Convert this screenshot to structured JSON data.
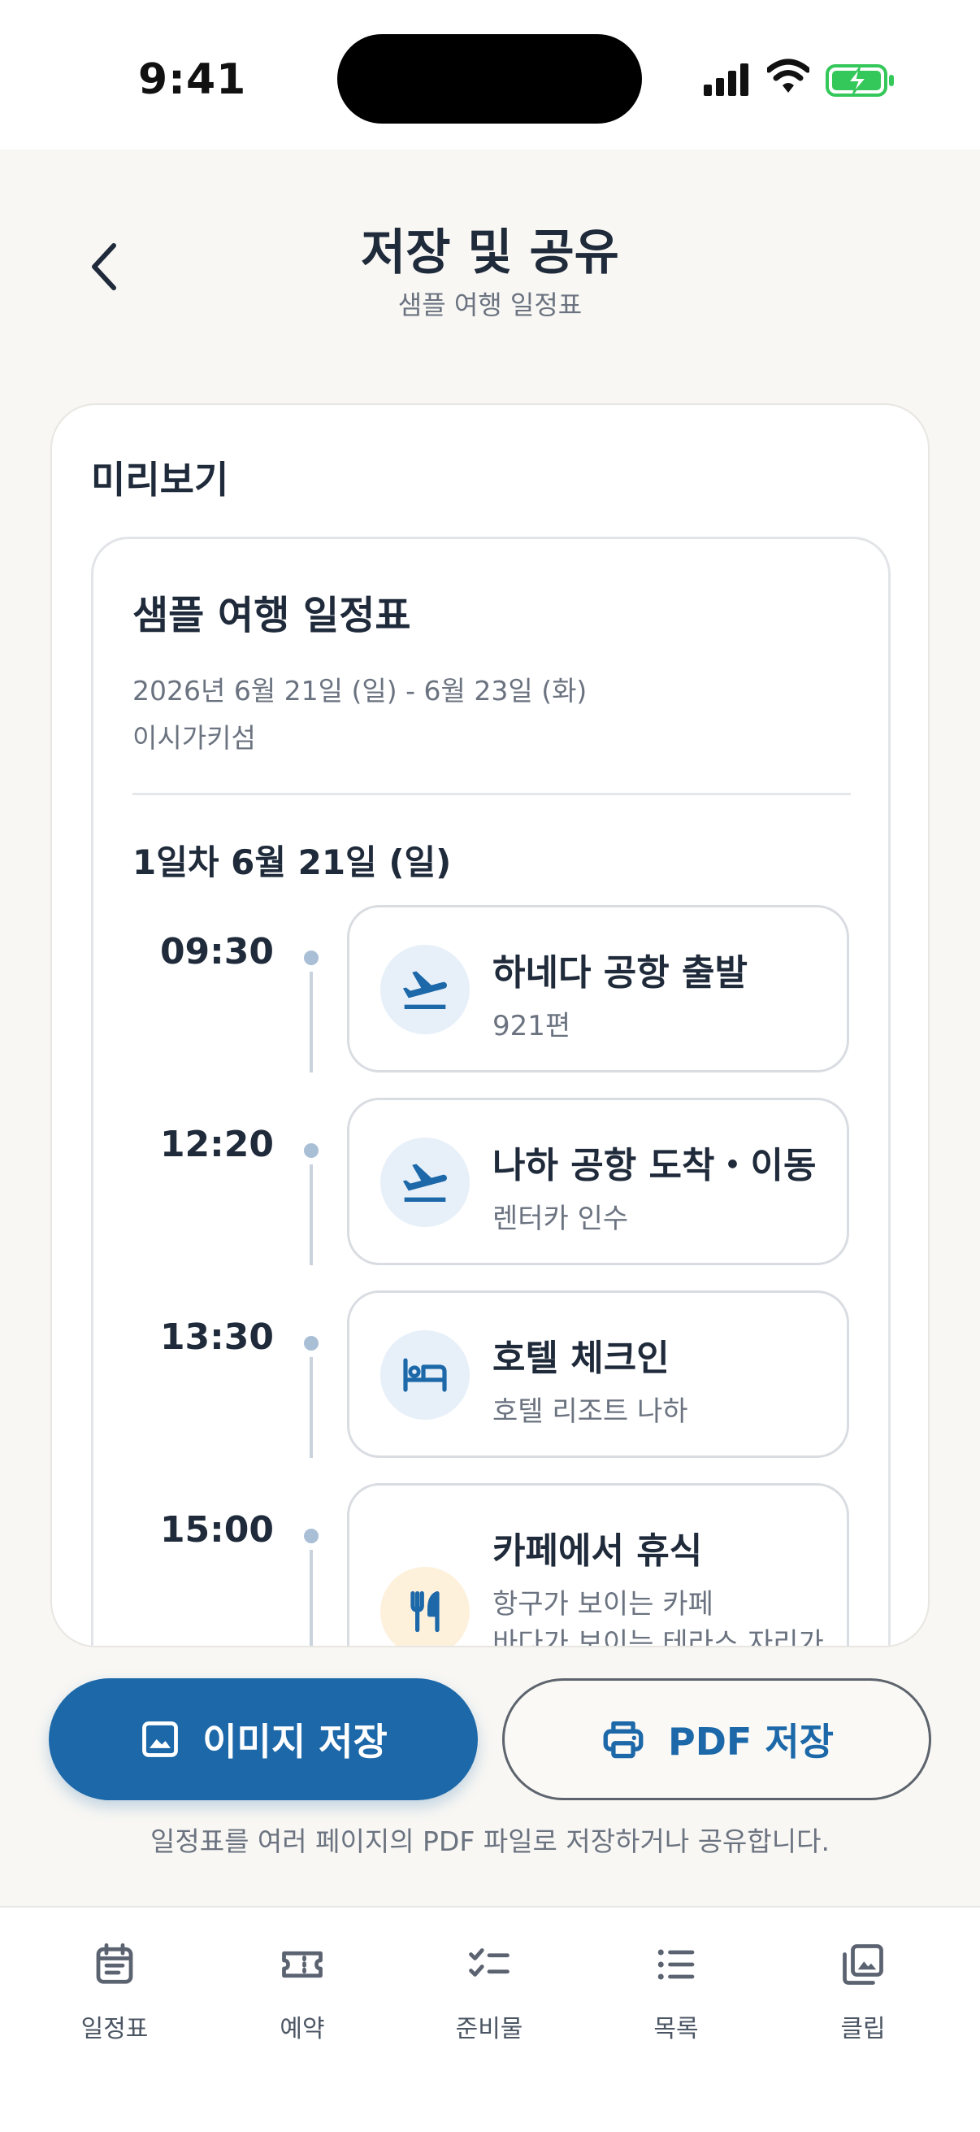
{
  "status_bar": {
    "time": "9:41"
  },
  "header": {
    "title": "저장 및 공유",
    "subtitle": "샘플 여행 일정표"
  },
  "preview": {
    "heading": "미리보기",
    "doc": {
      "title": "샘플 여행 일정표",
      "date_range": "2026년 6월 21일 (일) - 6월 23일 (화)",
      "place": "이시가키섬",
      "day_label": "1일차 6월 21일 (일)",
      "items": [
        {
          "time": "09:30",
          "title": "하네다 공항 출발",
          "sub": "921편",
          "icon": "airplane-icon"
        },
        {
          "time": "12:20",
          "title": "나하 공항 도착・이동",
          "sub": "렌터카 인수",
          "icon": "airplane-icon"
        },
        {
          "time": "13:30",
          "title": "호텔 체크인",
          "sub": "호텔 리조트 나하",
          "icon": "bed-icon"
        },
        {
          "time": "15:00",
          "title": "카페에서 휴식",
          "sub": "항구가 보이는 카페",
          "sub2": "바다가 보이는 테라스 자리가",
          "icon": "utensils-icon"
        }
      ]
    }
  },
  "actions": {
    "image_save": "이미지 저장",
    "pdf_save": "PDF 저장",
    "hint": "일정표를 여러 페이지의 PDF 파일로 저장하거나 공유합니다."
  },
  "tabs": [
    {
      "label": "일정표",
      "icon": "calendar-list-icon"
    },
    {
      "label": "예약",
      "icon": "ticket-icon"
    },
    {
      "label": "준비물",
      "icon": "checklist-icon"
    },
    {
      "label": "목록",
      "icon": "list-icon"
    },
    {
      "label": "클립",
      "icon": "gallery-icon"
    }
  ],
  "colors": {
    "primary": "#1c68a9",
    "text": "#1f2a3a",
    "muted": "#6b7380",
    "background": "#f8f7f4"
  }
}
